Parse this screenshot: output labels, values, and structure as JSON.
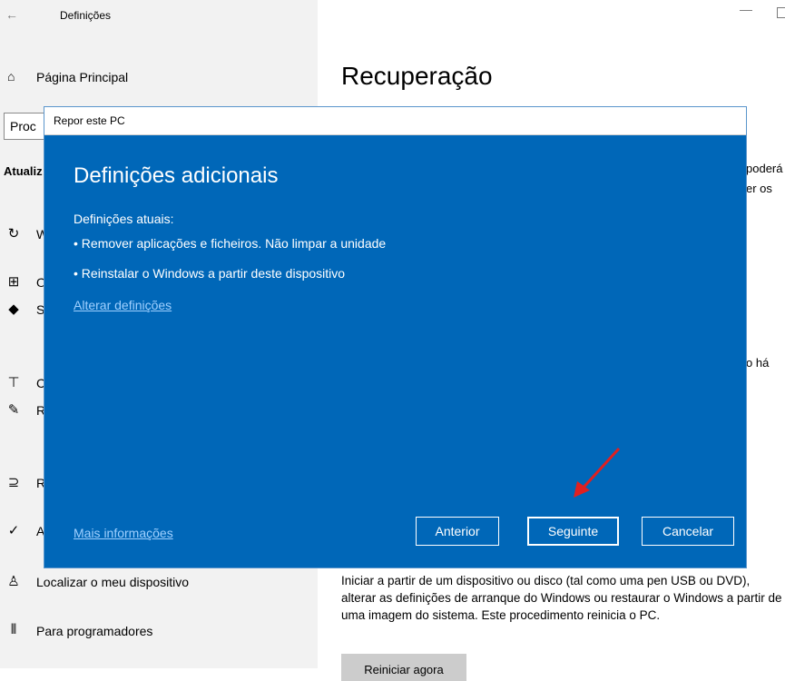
{
  "window": {
    "title": "Definições"
  },
  "sidebar": {
    "home_label": "Página Principal",
    "search_placeholder": "Procurar uma definição",
    "search_visible": "Proc",
    "section_heading": "Atualiz",
    "items": [
      {
        "label": "W",
        "icon": "refresh-icon"
      },
      {
        "label": "O",
        "icon": "delivery-optimization-icon"
      },
      {
        "label": "S",
        "icon": "shield-icon"
      },
      {
        "label": "C",
        "icon": "backup-upload-icon"
      },
      {
        "label": "R",
        "icon": "troubleshoot-wrench-icon"
      },
      {
        "label": "R",
        "icon": "recovery-icon"
      },
      {
        "label": "A",
        "icon": "activation-check-icon"
      },
      {
        "label": "Localizar o meu dispositivo",
        "icon": "find-device-icon"
      },
      {
        "label": "Para programadores",
        "icon": "developer-tools-icon"
      }
    ]
  },
  "main": {
    "title": "Recuperação",
    "peek_1a": "poderá",
    "peek_1b": "er os",
    "peek_2": "o há",
    "advanced_description": "Iniciar a partir de um dispositivo ou disco (tal como uma pen USB ou DVD), alterar as definições de arranque do Windows ou restaurar o Windows a partir de uma imagem do sistema. Este procedimento reinicia o PC.",
    "restart_button": "Reiniciar agora"
  },
  "dialog": {
    "title": "Repor este PC",
    "heading": "Definições adicionais",
    "current_label": "Definições atuais:",
    "bullet_1": "• Remover aplicações e ficheiros. Não limpar a unidade",
    "bullet_2": "•  Reinstalar o Windows a partir deste dispositivo",
    "change_link": "Alterar definições",
    "more_info_link": "Mais informações",
    "btn_back": "Anterior",
    "btn_next": "Seguinte",
    "btn_cancel": "Cancelar",
    "accent_color": "#0067b8",
    "annotation_color": "#e02020"
  }
}
